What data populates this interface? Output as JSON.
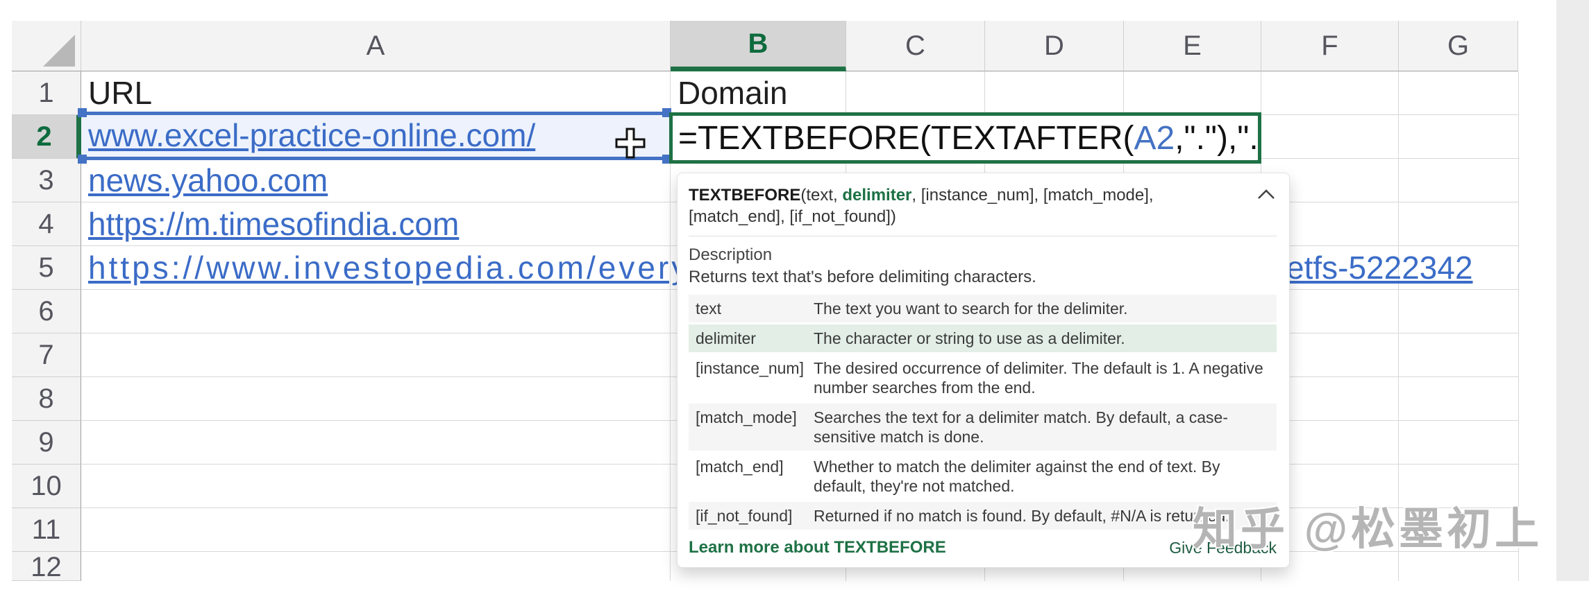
{
  "sheet": {
    "column_headers": [
      "A",
      "B",
      "C",
      "D",
      "E",
      "F",
      "G"
    ],
    "selected_column": "B",
    "row_headers": [
      "1",
      "2",
      "3",
      "4",
      "5",
      "6",
      "7",
      "8",
      "9",
      "10",
      "11",
      "12"
    ],
    "selected_row": "2",
    "cells": {
      "A1": "URL",
      "B1": "Domain",
      "A2": "www.excel-practice-online.com/",
      "A3": "news.yahoo.com",
      "A4": "https://m.timesofindia.com",
      "A5_visible_left": "https://www.investopedia.com/everything-yo",
      "A5_visible_right": "etfs-5222342"
    },
    "formula": {
      "prefix": "=TEXTBEFORE(TEXTAFTER(",
      "ref": "A2",
      "suffix": ",\".\"),\".\""
    }
  },
  "tooltip": {
    "signature": {
      "fn": "TEXTBEFORE",
      "before_active": "(text, ",
      "active": "delimiter",
      "after_active": ", [instance_num], [match_mode], [match_end], [if_not_found])"
    },
    "collapse_icon": "chevron-up-icon",
    "description_label": "Description",
    "description": "Returns text that's before delimiting characters.",
    "params": [
      {
        "name": "text",
        "desc": "The text you want to search for the delimiter.",
        "highlight": false,
        "shade": true
      },
      {
        "name": "delimiter",
        "desc": "The character or string to use as a delimiter.",
        "highlight": true,
        "shade": false
      },
      {
        "name": "[instance_num]",
        "desc": "The desired occurrence of delimiter. The default is 1. A negative number searches from the end.",
        "highlight": false,
        "shade": false
      },
      {
        "name": "[match_mode]",
        "desc": "Searches the text for a delimiter match. By default, a case-sensitive match is done.",
        "highlight": false,
        "shade": true
      },
      {
        "name": "[match_end]",
        "desc": "Whether to match the delimiter against the end of text. By default, they're not matched.",
        "highlight": false,
        "shade": false
      },
      {
        "name": "[if_not_found]",
        "desc": "Returned if no match is found. By default, #N/A is returned.",
        "highlight": false,
        "shade": true
      }
    ],
    "learn_more": "Learn more about TEXTBEFORE",
    "give_feedback": "Give Feedback"
  },
  "watermark": "知乎 @松墨初上",
  "colors": {
    "excel_green": "#1e7145",
    "reference_blue": "#4472c4",
    "hyperlink_blue": "#3b6cc7",
    "param_highlight_green": "#e3efe6"
  }
}
